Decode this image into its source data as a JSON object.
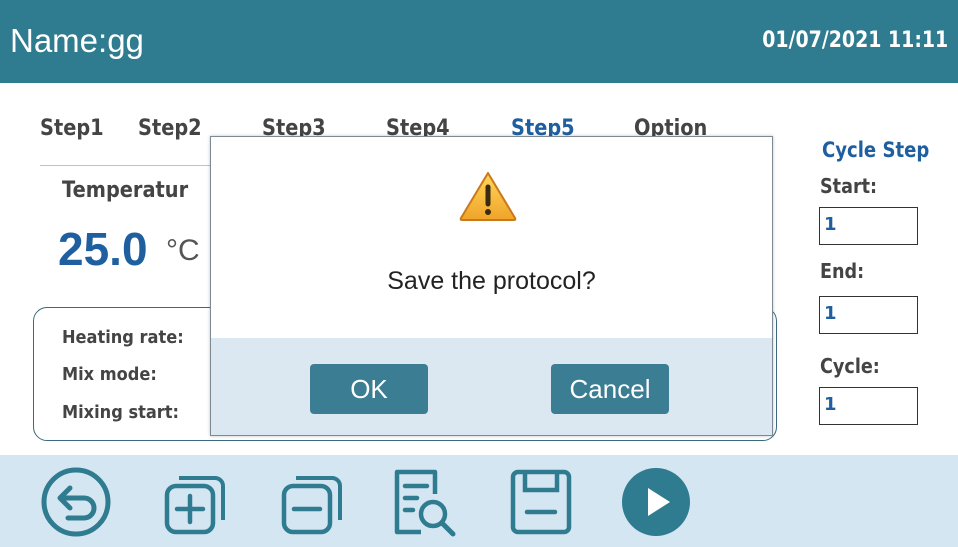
{
  "header": {
    "title": "Name:gg",
    "datetime": "01/07/2021 11:11"
  },
  "tabs": [
    {
      "label": "Step1",
      "active": false
    },
    {
      "label": "Step2",
      "active": false
    },
    {
      "label": "Step3",
      "active": false
    },
    {
      "label": "Step4",
      "active": false
    },
    {
      "label": "Step5",
      "active": true
    },
    {
      "label": "Option",
      "active": false
    }
  ],
  "step": {
    "temperature_label": "Temperatur",
    "temperature_value": "25.0",
    "temperature_unit": "°C",
    "heating_rate_label": "Heating rate:",
    "mix_mode_label": "Mix mode:",
    "mixing_start_label": "Mixing start:"
  },
  "cycle_step": {
    "title": "Cycle Step",
    "start_label": "Start:",
    "start_value": "1",
    "end_label": "End:",
    "end_value": "1",
    "cycle_label": "Cycle:",
    "cycle_value": "1"
  },
  "toolbar": {
    "icons": [
      "back-icon",
      "add-step-icon",
      "remove-step-icon",
      "preview-icon",
      "save-icon",
      "run-icon"
    ]
  },
  "dialog": {
    "icon": "warning-icon",
    "message": "Save the protocol?",
    "ok_label": "OK",
    "cancel_label": "Cancel"
  },
  "colors": {
    "header_bg": "#2f7b8f",
    "accent_blue": "#1f5f9f",
    "toolbar_bg": "#d5e6f3",
    "dialog_button": "#3b7d93",
    "warning": "#f0a32a"
  }
}
